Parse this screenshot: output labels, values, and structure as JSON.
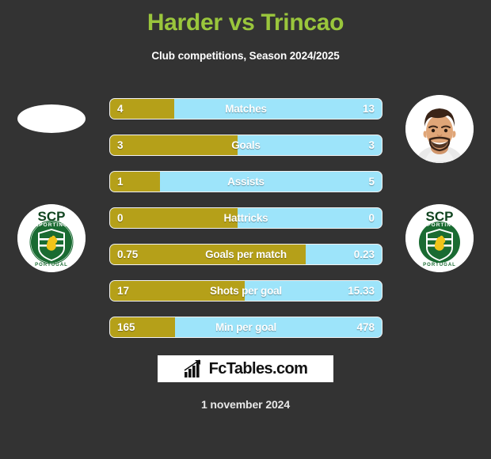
{
  "header": {
    "title": "Harder vs Trincao",
    "subtitle": "Club competitions, Season 2024/2025",
    "title_color": "#9ac63c",
    "background_color": "#333333"
  },
  "players": {
    "left": {
      "name": "Harder",
      "photo": "blank-avatar",
      "club_crest": "sporting-cp-crest",
      "crest_text_top": "SCP",
      "crest_text_ring": "SPORTING",
      "crest_text_bottom": "PORTUGAL"
    },
    "right": {
      "name": "Trincao",
      "photo": "player-portrait",
      "club_crest": "sporting-cp-crest",
      "crest_text_top": "SCP",
      "crest_text_ring": "SPORTING",
      "crest_text_bottom": "PORTUGAL"
    }
  },
  "chart_data": {
    "type": "bar",
    "title": "Harder vs Trincao",
    "subtitle": "Club competitions, Season 2024/2025",
    "orientation": "horizontal-diverging",
    "series": [
      {
        "name": "Harder",
        "color": "#b5a019",
        "side": "left"
      },
      {
        "name": "Trincao",
        "color": "#9de4fa",
        "side": "right"
      }
    ],
    "categories": [
      "Matches",
      "Goals",
      "Assists",
      "Hattricks",
      "Goals per match",
      "Shots per goal",
      "Min per goal"
    ],
    "rows": [
      {
        "label": "Matches",
        "left_value": "4",
        "right_value": "13",
        "left_pct": 23.5
      },
      {
        "label": "Goals",
        "left_value": "3",
        "right_value": "3",
        "left_pct": 47.0
      },
      {
        "label": "Assists",
        "left_value": "1",
        "right_value": "5",
        "left_pct": 18.5
      },
      {
        "label": "Hattricks",
        "left_value": "0",
        "right_value": "0",
        "left_pct": 47.0
      },
      {
        "label": "Goals per match",
        "left_value": "0.75",
        "right_value": "0.23",
        "left_pct": 72.0
      },
      {
        "label": "Shots per goal",
        "left_value": "17",
        "right_value": "15.33",
        "left_pct": 49.5
      },
      {
        "label": "Min per goal",
        "left_value": "165",
        "right_value": "478",
        "left_pct": 24.0
      }
    ]
  },
  "footer": {
    "brand_name": "FcTables.com",
    "brand_icon": "bar-chart-icon",
    "date": "1 november 2024"
  }
}
